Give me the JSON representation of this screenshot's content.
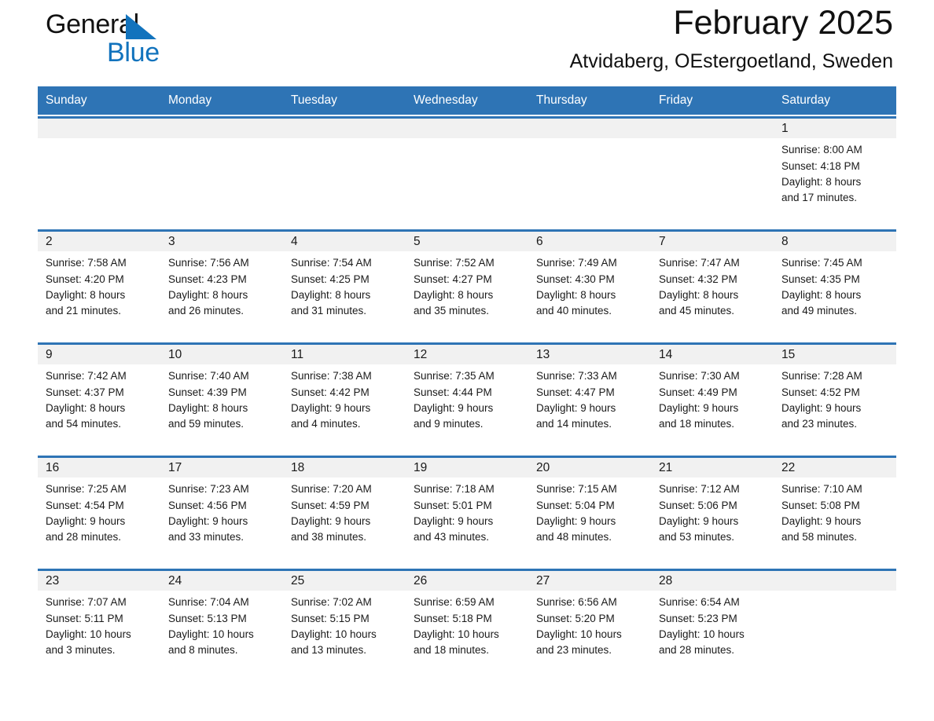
{
  "brand": {
    "name_part1": "General",
    "name_part2": "Blue",
    "accent_color": "#1273bd"
  },
  "header": {
    "title": "February 2025",
    "subtitle": "Atvidaberg, OEstergoetland, Sweden",
    "header_bg_color": "#2e74b5"
  },
  "weekdays": [
    {
      "label": "Sunday"
    },
    {
      "label": "Monday"
    },
    {
      "label": "Tuesday"
    },
    {
      "label": "Wednesday"
    },
    {
      "label": "Thursday"
    },
    {
      "label": "Friday"
    },
    {
      "label": "Saturday"
    }
  ],
  "weeks": [
    [
      {
        "day": "",
        "sunrise": "",
        "sunset": "",
        "daylight_line1": "",
        "daylight_line2": ""
      },
      {
        "day": "",
        "sunrise": "",
        "sunset": "",
        "daylight_line1": "",
        "daylight_line2": ""
      },
      {
        "day": "",
        "sunrise": "",
        "sunset": "",
        "daylight_line1": "",
        "daylight_line2": ""
      },
      {
        "day": "",
        "sunrise": "",
        "sunset": "",
        "daylight_line1": "",
        "daylight_line2": ""
      },
      {
        "day": "",
        "sunrise": "",
        "sunset": "",
        "daylight_line1": "",
        "daylight_line2": ""
      },
      {
        "day": "",
        "sunrise": "",
        "sunset": "",
        "daylight_line1": "",
        "daylight_line2": ""
      },
      {
        "day": "1",
        "sunrise": "Sunrise: 8:00 AM",
        "sunset": "Sunset: 4:18 PM",
        "daylight_line1": "Daylight: 8 hours",
        "daylight_line2": "and 17 minutes."
      }
    ],
    [
      {
        "day": "2",
        "sunrise": "Sunrise: 7:58 AM",
        "sunset": "Sunset: 4:20 PM",
        "daylight_line1": "Daylight: 8 hours",
        "daylight_line2": "and 21 minutes."
      },
      {
        "day": "3",
        "sunrise": "Sunrise: 7:56 AM",
        "sunset": "Sunset: 4:23 PM",
        "daylight_line1": "Daylight: 8 hours",
        "daylight_line2": "and 26 minutes."
      },
      {
        "day": "4",
        "sunrise": "Sunrise: 7:54 AM",
        "sunset": "Sunset: 4:25 PM",
        "daylight_line1": "Daylight: 8 hours",
        "daylight_line2": "and 31 minutes."
      },
      {
        "day": "5",
        "sunrise": "Sunrise: 7:52 AM",
        "sunset": "Sunset: 4:27 PM",
        "daylight_line1": "Daylight: 8 hours",
        "daylight_line2": "and 35 minutes."
      },
      {
        "day": "6",
        "sunrise": "Sunrise: 7:49 AM",
        "sunset": "Sunset: 4:30 PM",
        "daylight_line1": "Daylight: 8 hours",
        "daylight_line2": "and 40 minutes."
      },
      {
        "day": "7",
        "sunrise": "Sunrise: 7:47 AM",
        "sunset": "Sunset: 4:32 PM",
        "daylight_line1": "Daylight: 8 hours",
        "daylight_line2": "and 45 minutes."
      },
      {
        "day": "8",
        "sunrise": "Sunrise: 7:45 AM",
        "sunset": "Sunset: 4:35 PM",
        "daylight_line1": "Daylight: 8 hours",
        "daylight_line2": "and 49 minutes."
      }
    ],
    [
      {
        "day": "9",
        "sunrise": "Sunrise: 7:42 AM",
        "sunset": "Sunset: 4:37 PM",
        "daylight_line1": "Daylight: 8 hours",
        "daylight_line2": "and 54 minutes."
      },
      {
        "day": "10",
        "sunrise": "Sunrise: 7:40 AM",
        "sunset": "Sunset: 4:39 PM",
        "daylight_line1": "Daylight: 8 hours",
        "daylight_line2": "and 59 minutes."
      },
      {
        "day": "11",
        "sunrise": "Sunrise: 7:38 AM",
        "sunset": "Sunset: 4:42 PM",
        "daylight_line1": "Daylight: 9 hours",
        "daylight_line2": "and 4 minutes."
      },
      {
        "day": "12",
        "sunrise": "Sunrise: 7:35 AM",
        "sunset": "Sunset: 4:44 PM",
        "daylight_line1": "Daylight: 9 hours",
        "daylight_line2": "and 9 minutes."
      },
      {
        "day": "13",
        "sunrise": "Sunrise: 7:33 AM",
        "sunset": "Sunset: 4:47 PM",
        "daylight_line1": "Daylight: 9 hours",
        "daylight_line2": "and 14 minutes."
      },
      {
        "day": "14",
        "sunrise": "Sunrise: 7:30 AM",
        "sunset": "Sunset: 4:49 PM",
        "daylight_line1": "Daylight: 9 hours",
        "daylight_line2": "and 18 minutes."
      },
      {
        "day": "15",
        "sunrise": "Sunrise: 7:28 AM",
        "sunset": "Sunset: 4:52 PM",
        "daylight_line1": "Daylight: 9 hours",
        "daylight_line2": "and 23 minutes."
      }
    ],
    [
      {
        "day": "16",
        "sunrise": "Sunrise: 7:25 AM",
        "sunset": "Sunset: 4:54 PM",
        "daylight_line1": "Daylight: 9 hours",
        "daylight_line2": "and 28 minutes."
      },
      {
        "day": "17",
        "sunrise": "Sunrise: 7:23 AM",
        "sunset": "Sunset: 4:56 PM",
        "daylight_line1": "Daylight: 9 hours",
        "daylight_line2": "and 33 minutes."
      },
      {
        "day": "18",
        "sunrise": "Sunrise: 7:20 AM",
        "sunset": "Sunset: 4:59 PM",
        "daylight_line1": "Daylight: 9 hours",
        "daylight_line2": "and 38 minutes."
      },
      {
        "day": "19",
        "sunrise": "Sunrise: 7:18 AM",
        "sunset": "Sunset: 5:01 PM",
        "daylight_line1": "Daylight: 9 hours",
        "daylight_line2": "and 43 minutes."
      },
      {
        "day": "20",
        "sunrise": "Sunrise: 7:15 AM",
        "sunset": "Sunset: 5:04 PM",
        "daylight_line1": "Daylight: 9 hours",
        "daylight_line2": "and 48 minutes."
      },
      {
        "day": "21",
        "sunrise": "Sunrise: 7:12 AM",
        "sunset": "Sunset: 5:06 PM",
        "daylight_line1": "Daylight: 9 hours",
        "daylight_line2": "and 53 minutes."
      },
      {
        "day": "22",
        "sunrise": "Sunrise: 7:10 AM",
        "sunset": "Sunset: 5:08 PM",
        "daylight_line1": "Daylight: 9 hours",
        "daylight_line2": "and 58 minutes."
      }
    ],
    [
      {
        "day": "23",
        "sunrise": "Sunrise: 7:07 AM",
        "sunset": "Sunset: 5:11 PM",
        "daylight_line1": "Daylight: 10 hours",
        "daylight_line2": "and 3 minutes."
      },
      {
        "day": "24",
        "sunrise": "Sunrise: 7:04 AM",
        "sunset": "Sunset: 5:13 PM",
        "daylight_line1": "Daylight: 10 hours",
        "daylight_line2": "and 8 minutes."
      },
      {
        "day": "25",
        "sunrise": "Sunrise: 7:02 AM",
        "sunset": "Sunset: 5:15 PM",
        "daylight_line1": "Daylight: 10 hours",
        "daylight_line2": "and 13 minutes."
      },
      {
        "day": "26",
        "sunrise": "Sunrise: 6:59 AM",
        "sunset": "Sunset: 5:18 PM",
        "daylight_line1": "Daylight: 10 hours",
        "daylight_line2": "and 18 minutes."
      },
      {
        "day": "27",
        "sunrise": "Sunrise: 6:56 AM",
        "sunset": "Sunset: 5:20 PM",
        "daylight_line1": "Daylight: 10 hours",
        "daylight_line2": "and 23 minutes."
      },
      {
        "day": "28",
        "sunrise": "Sunrise: 6:54 AM",
        "sunset": "Sunset: 5:23 PM",
        "daylight_line1": "Daylight: 10 hours",
        "daylight_line2": "and 28 minutes."
      },
      {
        "day": "",
        "sunrise": "",
        "sunset": "",
        "daylight_line1": "",
        "daylight_line2": ""
      }
    ]
  ]
}
